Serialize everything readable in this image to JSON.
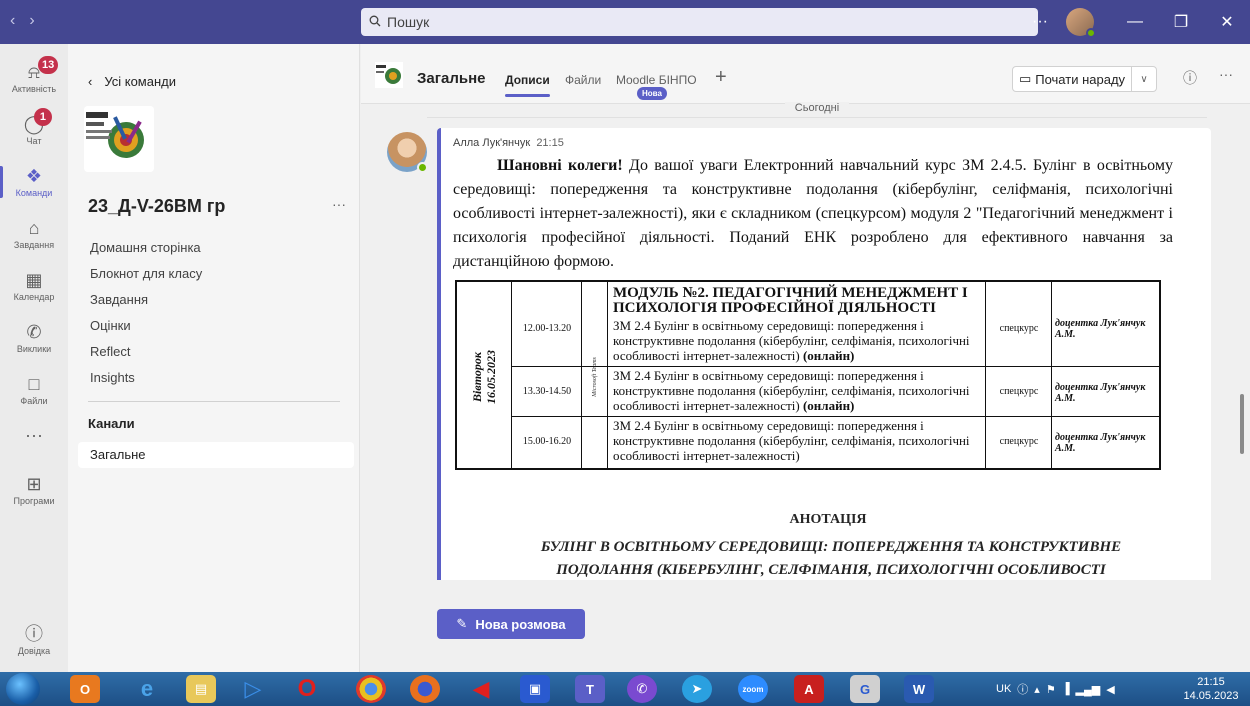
{
  "titlebar": {
    "search_placeholder": "Пошук",
    "more": "···"
  },
  "rail": {
    "items": [
      {
        "label": "Активність",
        "icon": "bell-icon",
        "badge": "13"
      },
      {
        "label": "Чат",
        "icon": "chat-icon",
        "badge": "1"
      },
      {
        "label": "Команди",
        "icon": "teams-icon",
        "badge": ""
      },
      {
        "label": "Завдання",
        "icon": "assignments-icon",
        "badge": ""
      },
      {
        "label": "Календар",
        "icon": "calendar-icon",
        "badge": ""
      },
      {
        "label": "Виклики",
        "icon": "phone-icon",
        "badge": ""
      },
      {
        "label": "Файли",
        "icon": "file-icon",
        "badge": ""
      },
      {
        "label": "···",
        "icon": "more-icon",
        "badge": ""
      },
      {
        "label": "Програми",
        "icon": "apps-icon",
        "badge": ""
      },
      {
        "label": "Довідка",
        "icon": "help-icon",
        "badge": ""
      }
    ],
    "accent": "#5b5fc7"
  },
  "teampanel": {
    "back_label": "Усі команди",
    "team_name": "23_Д-V-26ВМ гр",
    "more": "···",
    "nav": [
      "Домашня сторінка",
      "Блокнот для класу",
      "Завдання",
      "Оцінки",
      "Reflect",
      "Insights"
    ],
    "channels_label": "Канали",
    "channel": "Загальне"
  },
  "channel_header": {
    "title": "Загальне",
    "tabs": [
      "Дописи",
      "Файли",
      "Moodle БІНПО"
    ],
    "new_badge": "Нова",
    "meet_label": "Почати нараду"
  },
  "feed": {
    "date_divider": "Сьогодні",
    "author": "Алла Лук'янчук",
    "time": "21:15",
    "greeting": "Шановні колеги!",
    "body": " До вашої уваги Електронний навчальний курс ЗМ 2.4.5. Булінг в освітньому середовищі: попередження та конструктивне подолання (кібербулінг, селіфманія, психологічні особливості інтернет-залежності), яки є складником (спецкурсом) модуля 2 \"Педагогічний менеджмент і психологія професійної діяльності. Поданий ЕНК розроблено для ефективного навчання за дистанційною формою.",
    "schedule": {
      "day": "Вівторок",
      "date": "16.05.2023",
      "platform": "Microsoft Teams",
      "title": "МОДУЛЬ №2. ПЕДАГОГІЧНИЙ МЕНЕДЖМЕНТ І ПСИХОЛОГІЯ ПРОФЕСІЙНОЇ ДІЯЛЬНОСТІ",
      "rows": [
        {
          "time": "12.00-13.20",
          "subject": "ЗМ 2.4 Булінг в освітньому середовищі: попередження і конструктивне подолання (кібербулінг, селфіманія, психологічні особливості інтернет-залежності)",
          "mode": " (онлайн)",
          "type": "спецкурс",
          "lecturer": "доцентка Лук'янчук А.М."
        },
        {
          "time": "13.30-14.50",
          "subject": "ЗМ 2.4 Булінг в освітньому середовищі: попередження і конструктивне подолання (кібербулінг, селфіманія, психологічні особливості інтернет-залежності)",
          "mode": " (онлайн)",
          "type": "спецкурс",
          "lecturer": "доцентка Лук'янчук А.М."
        },
        {
          "time": "15.00-16.20",
          "subject": "ЗМ 2.4 Булінг в освітньому середовищі: попередження і конструктивне подолання (кібербулінг, селфіманія, психологічні особливості інтернет-залежності)",
          "mode": "",
          "type": "спецкурс",
          "lecturer": "доцентка Лук'янчук А.М."
        }
      ]
    },
    "annotation_title": "АНОТАЦІЯ",
    "annotation_text": "БУЛІНГ В ОСВІТНЬОМУ СЕРЕДОВИЩІ: ПОПЕРЕДЖЕННЯ ТА КОНСТРУКТИВНЕ ПОДОЛАННЯ (КІБЕРБУЛІНГ, СЕЛФІМАНІЯ, ПСИХОЛОГІЧНІ ОСОБЛИВОСТІ",
    "compose_label": "Нова розмова"
  },
  "taskbar": {
    "lang": "UK",
    "time": "21:15",
    "date": "14.05.2023"
  }
}
